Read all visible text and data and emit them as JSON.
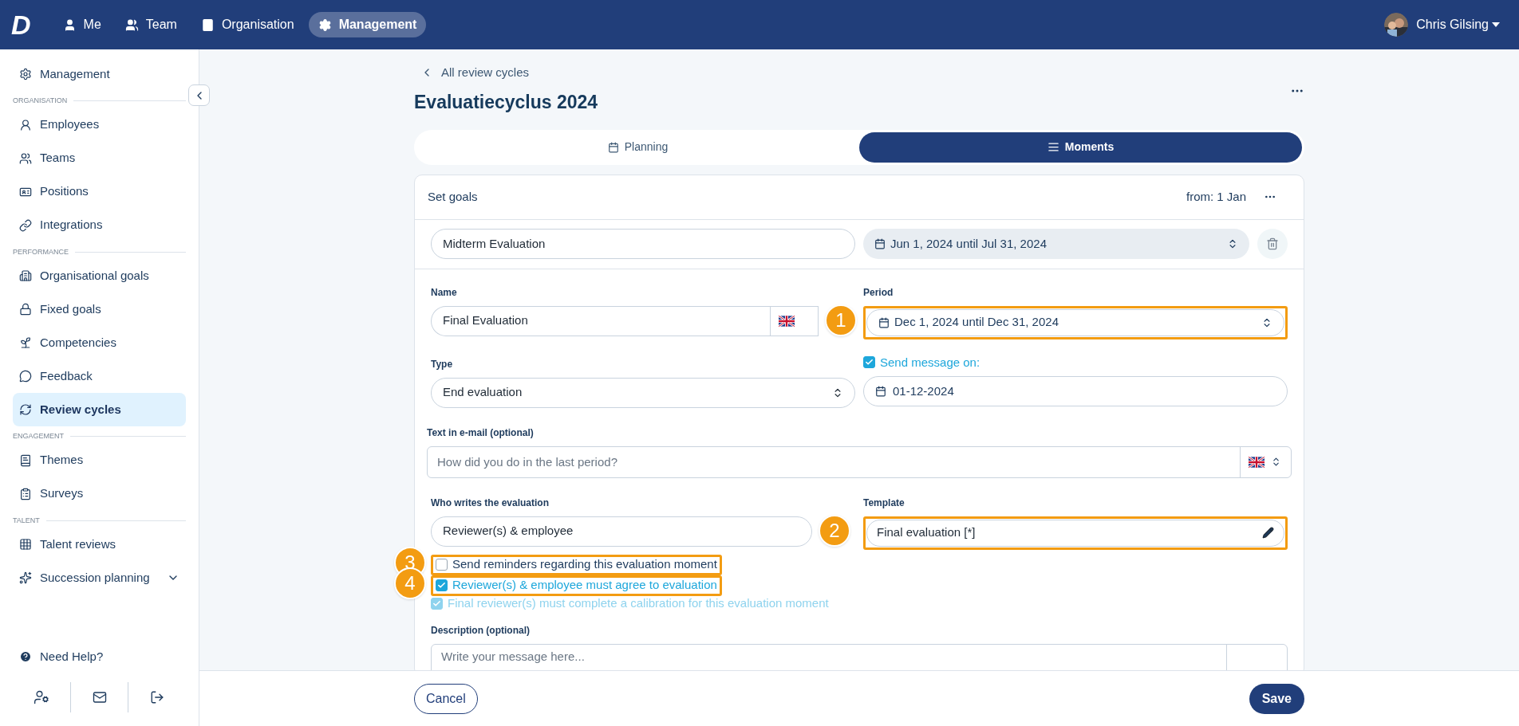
{
  "topbar": {
    "logo": "D",
    "items": [
      {
        "label": "Me",
        "selected": false
      },
      {
        "label": "Team",
        "selected": false
      },
      {
        "label": "Organisation",
        "selected": false
      },
      {
        "label": "Management",
        "selected": true
      }
    ],
    "user": {
      "name": "Chris Gilsing"
    }
  },
  "sidebar": {
    "groups": [
      {
        "items": [
          {
            "label": "Management",
            "selected": false
          }
        ]
      },
      {
        "heading": "ORGANISATION",
        "items": [
          {
            "label": "Employees",
            "selected": false
          },
          {
            "label": "Teams",
            "selected": false
          },
          {
            "label": "Positions",
            "selected": false
          },
          {
            "label": "Integrations",
            "selected": false
          }
        ]
      },
      {
        "heading": "PERFORMANCE",
        "items": [
          {
            "label": "Organisational goals",
            "selected": false
          },
          {
            "label": "Fixed goals",
            "selected": false
          },
          {
            "label": "Competencies",
            "selected": false
          },
          {
            "label": "Feedback",
            "selected": false
          },
          {
            "label": "Review cycles",
            "selected": true
          }
        ]
      },
      {
        "heading": "ENGAGEMENT",
        "items": [
          {
            "label": "Themes",
            "selected": false
          },
          {
            "label": "Surveys",
            "selected": false
          }
        ]
      },
      {
        "heading": "TALENT",
        "items": [
          {
            "label": "Talent reviews",
            "selected": false
          },
          {
            "label": "Succession planning",
            "selected": false,
            "expanded": false
          }
        ]
      }
    ],
    "help": "Need Help?"
  },
  "page": {
    "back": "All review cycles",
    "title": "Evaluatiecyclus 2024",
    "tabs": [
      {
        "label": "Planning",
        "selected": false
      },
      {
        "label": "Moments",
        "selected": true
      }
    ]
  },
  "card": {
    "title": "Set goals",
    "from": "from: 1 Jan",
    "moment": {
      "name": "Midterm Evaluation",
      "period": "Jun 1, 2024 until Jul 31, 2024"
    },
    "form": {
      "name": {
        "label": "Name",
        "value": "Final Evaluation"
      },
      "period": {
        "label": "Period",
        "value": "Dec 1, 2024 until Dec 31, 2024",
        "callout": "1"
      },
      "type": {
        "label": "Type",
        "value": "End evaluation"
      },
      "send_message": {
        "label": "Send message on:",
        "checked": true,
        "value": "01-12-2024"
      },
      "email_text": {
        "label": "Text in e-mail (optional)",
        "placeholder": "How did you do in the last period?"
      },
      "writer": {
        "label": "Who writes the evaluation",
        "value": "Reviewer(s) & employee"
      },
      "template": {
        "label": "Template",
        "value": "Final evaluation [*]",
        "callout": "2"
      },
      "options": [
        {
          "label": "Send reminders regarding this evaluation moment",
          "checked": false,
          "disabled": false,
          "callout": "3"
        },
        {
          "label": "Reviewer(s) & employee must agree to evaluation",
          "checked": true,
          "disabled": false,
          "callout": "4"
        },
        {
          "label": "Final reviewer(s) must complete a calibration for this evaluation moment",
          "checked": true,
          "disabled": true
        }
      ],
      "description": {
        "label": "Description (optional)",
        "placeholder": "Write your message here..."
      }
    }
  },
  "footer": {
    "cancel": "Cancel",
    "save": "Save"
  }
}
